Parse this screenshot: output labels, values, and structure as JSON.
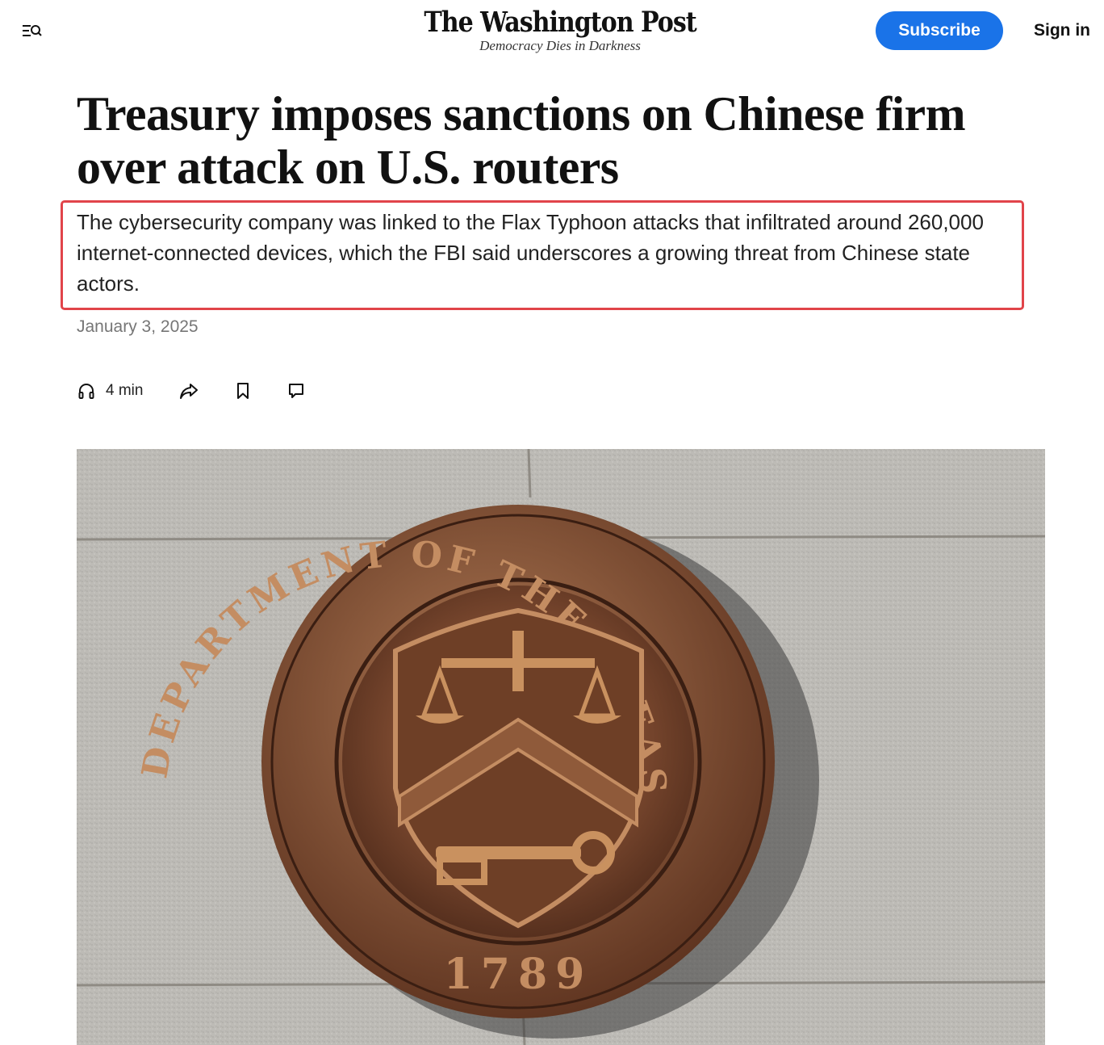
{
  "header": {
    "logo_text": "The Washington Post",
    "tagline": "Democracy Dies in Darkness",
    "subscribe_label": "Subscribe",
    "signin_label": "Sign in",
    "menu_icon": "menu-search-icon",
    "accent_color": "#1a73e8"
  },
  "article": {
    "headline": "Treasury imposes sanctions on Chinese firm over attack on U.S. routers",
    "dek": "The cybersecurity company was linked to the Flax Typhoon attacks that infiltrated around 260,000 internet-connected devices, which the FBI said underscores a growing threat from Chinese state actors.",
    "date": "January 3, 2025",
    "highlight_color": "#e1444a"
  },
  "toolbar": {
    "listen_label": "4 min",
    "listen_icon": "headphones-icon",
    "share_icon": "share-icon",
    "bookmark_icon": "bookmark-icon",
    "comment_icon": "comment-icon"
  },
  "image": {
    "seal_top_text": "THE DEPARTMENT OF THE TREASURY",
    "seal_year": "1789"
  }
}
